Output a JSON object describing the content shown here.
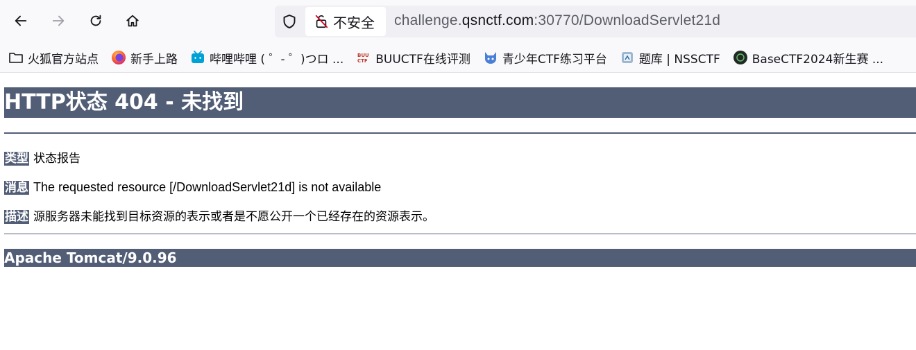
{
  "browser": {
    "security_label": "不安全",
    "url": {
      "prefix": "challenge.",
      "domain": "qsnctf.com",
      "suffix": ":30770/DownloadServlet21d"
    },
    "icons": {
      "back": "back-arrow-icon",
      "forward": "forward-arrow-icon",
      "reload": "reload-icon",
      "home": "home-icon",
      "shield": "shield-icon",
      "insecure": "insecure-lock-icon"
    }
  },
  "bookmarks": [
    {
      "label": "火狐官方站点",
      "icon": "folder-icon"
    },
    {
      "label": "新手上路",
      "icon": "firefox-icon"
    },
    {
      "label": "哔哩哔哩 ( ゜- ゜)つロ ...",
      "icon": "bilibili-icon"
    },
    {
      "label": "BUUCTF在线评测",
      "icon": "buuctf-icon"
    },
    {
      "label": "青少年CTF练习平台",
      "icon": "cat-icon"
    },
    {
      "label": "题库 | NSSCTF",
      "icon": "nssctf-icon"
    },
    {
      "label": "BaseCTF2024新生赛 ...",
      "icon": "basectf-icon"
    }
  ],
  "page": {
    "title": "HTTP状态 404 - 未找到",
    "type_label": "类型",
    "type_value": "状态报告",
    "message_label": "消息",
    "message_value": "The requested resource [/DownloadServlet21d] is not available",
    "description_label": "描述",
    "description_value": "源服务器未能找到目标资源的表示或者是不愿公开一个已经存在的资源表示。",
    "server": "Apache Tomcat/9.0.96"
  },
  "colors": {
    "tomcat_header": "#525d76",
    "chrome_bg": "#f9f9fb",
    "urlbar_bg": "#f0f0f4"
  }
}
